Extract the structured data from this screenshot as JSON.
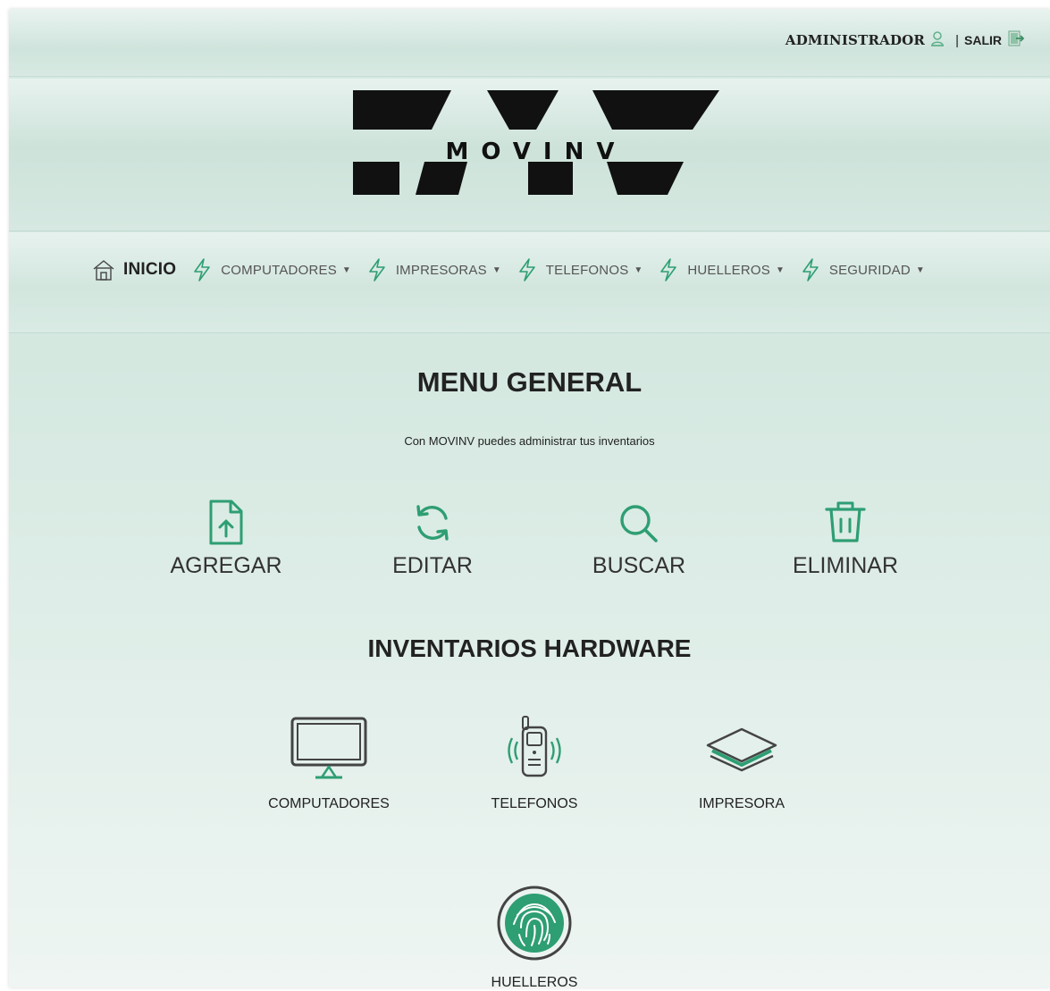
{
  "header": {
    "user_label": "ADMINISTRADOR",
    "separator": "|",
    "logout_label": "SALIR"
  },
  "logo": {
    "big_letters": "MV",
    "brand_text": "MOVINV"
  },
  "nav": {
    "items": [
      {
        "label": "INICIO",
        "icon": "home-icon",
        "dropdown": false
      },
      {
        "label": "COMPUTADORES",
        "icon": "lightning-icon",
        "dropdown": true
      },
      {
        "label": "IMPRESORAS",
        "icon": "lightning-icon",
        "dropdown": true
      },
      {
        "label": "TELEFONOS",
        "icon": "lightning-icon",
        "dropdown": true
      },
      {
        "label": "HUELLEROS",
        "icon": "lightning-icon",
        "dropdown": true
      },
      {
        "label": "SEGURIDAD",
        "icon": "lightning-icon",
        "dropdown": true
      }
    ]
  },
  "main": {
    "title": "MENU GENERAL",
    "subtitle": "Con MOVINV puedes administrar tus inventarios",
    "actions": [
      {
        "label": "AGREGAR",
        "icon": "file-upload-icon"
      },
      {
        "label": "EDITAR",
        "icon": "refresh-icon"
      },
      {
        "label": "BUSCAR",
        "icon": "search-icon"
      },
      {
        "label": "ELIMINAR",
        "icon": "trash-icon"
      }
    ],
    "hardware_title": "INVENTARIOS HARDWARE",
    "hardware": [
      {
        "label": "COMPUTADORES",
        "icon": "monitor-icon"
      },
      {
        "label": "TELEFONOS",
        "icon": "phone-icon"
      },
      {
        "label": "IMPRESORA",
        "icon": "layers-icon"
      },
      {
        "label": "HUELLEROS",
        "icon": "fingerprint-icon"
      }
    ]
  },
  "colors": {
    "accent": "#2e9e73",
    "background": "#d4e8e0",
    "text": "#222222"
  }
}
